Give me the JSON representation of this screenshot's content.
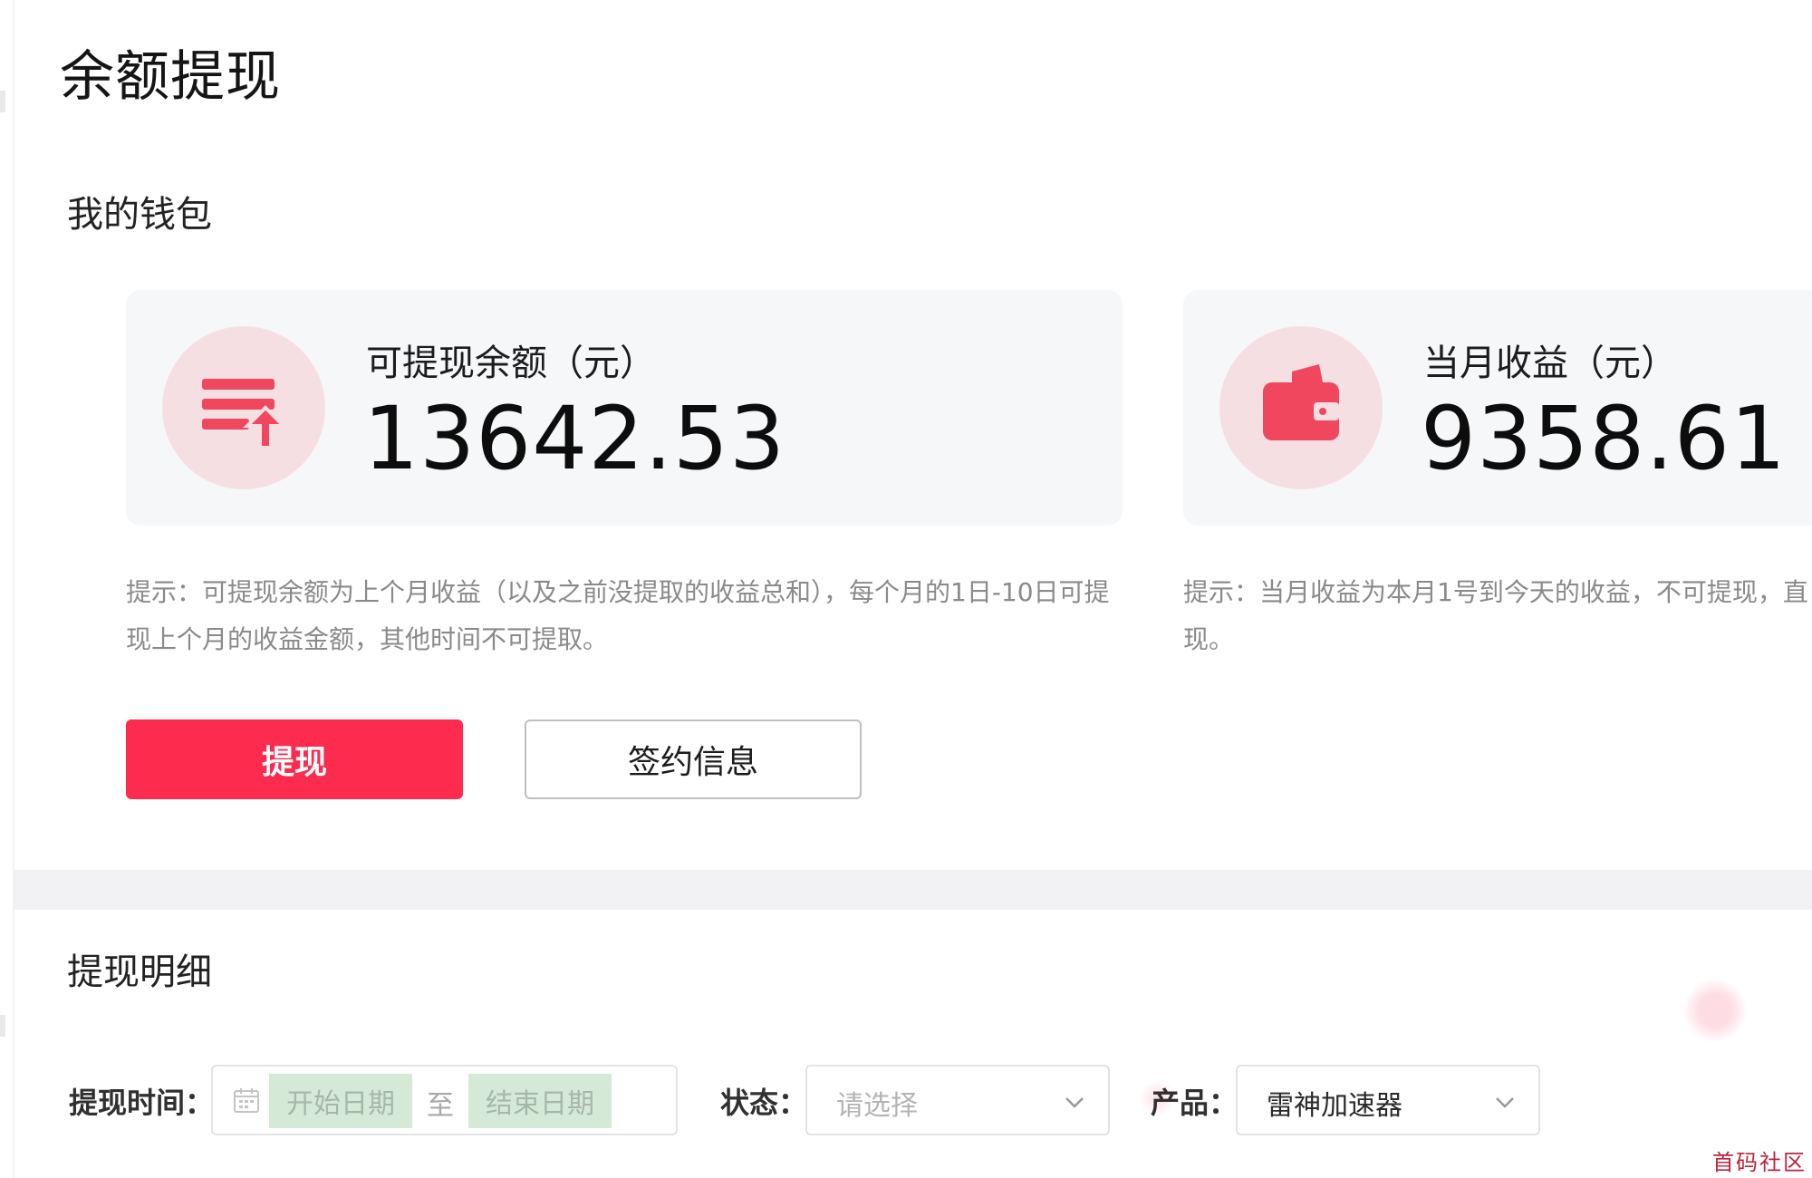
{
  "page": {
    "title": "余额提现"
  },
  "wallet": {
    "section_title": "我的钱包",
    "cards": [
      {
        "label": "可提现余额（元）",
        "value": "13642.53",
        "icon": "withdraw-list-icon",
        "hint": "提示：可提现余额为上个月收益（以及之前没提取的收益总和），每个月的1日-10日可提现上个月的收益金额，其他时间不可提取。"
      },
      {
        "label": "当月收益（元）",
        "value": "9358.61",
        "icon": "wallet-icon",
        "hint": "提示：当月收益为本月1号到今天的收益，不可提现，直\n现。"
      }
    ],
    "withdraw_button": "提现",
    "contract_button": "签约信息"
  },
  "details": {
    "section_title": "提现明细",
    "filters": {
      "time_label": "提现时间：",
      "start_placeholder": "开始日期",
      "separator": "至",
      "end_placeholder": "结束日期",
      "status_label": "状态：",
      "status_placeholder": "请选择",
      "product_label": "产品：",
      "product_value": "雷神加速器"
    }
  },
  "watermark": "首码社区",
  "colors": {
    "accent": "#fd2c4e",
    "icon_bg": "#f6dfe2",
    "icon_fg": "#f0475f",
    "card_bg": "#f6f7f9",
    "hint_text": "#8a8a8a"
  }
}
